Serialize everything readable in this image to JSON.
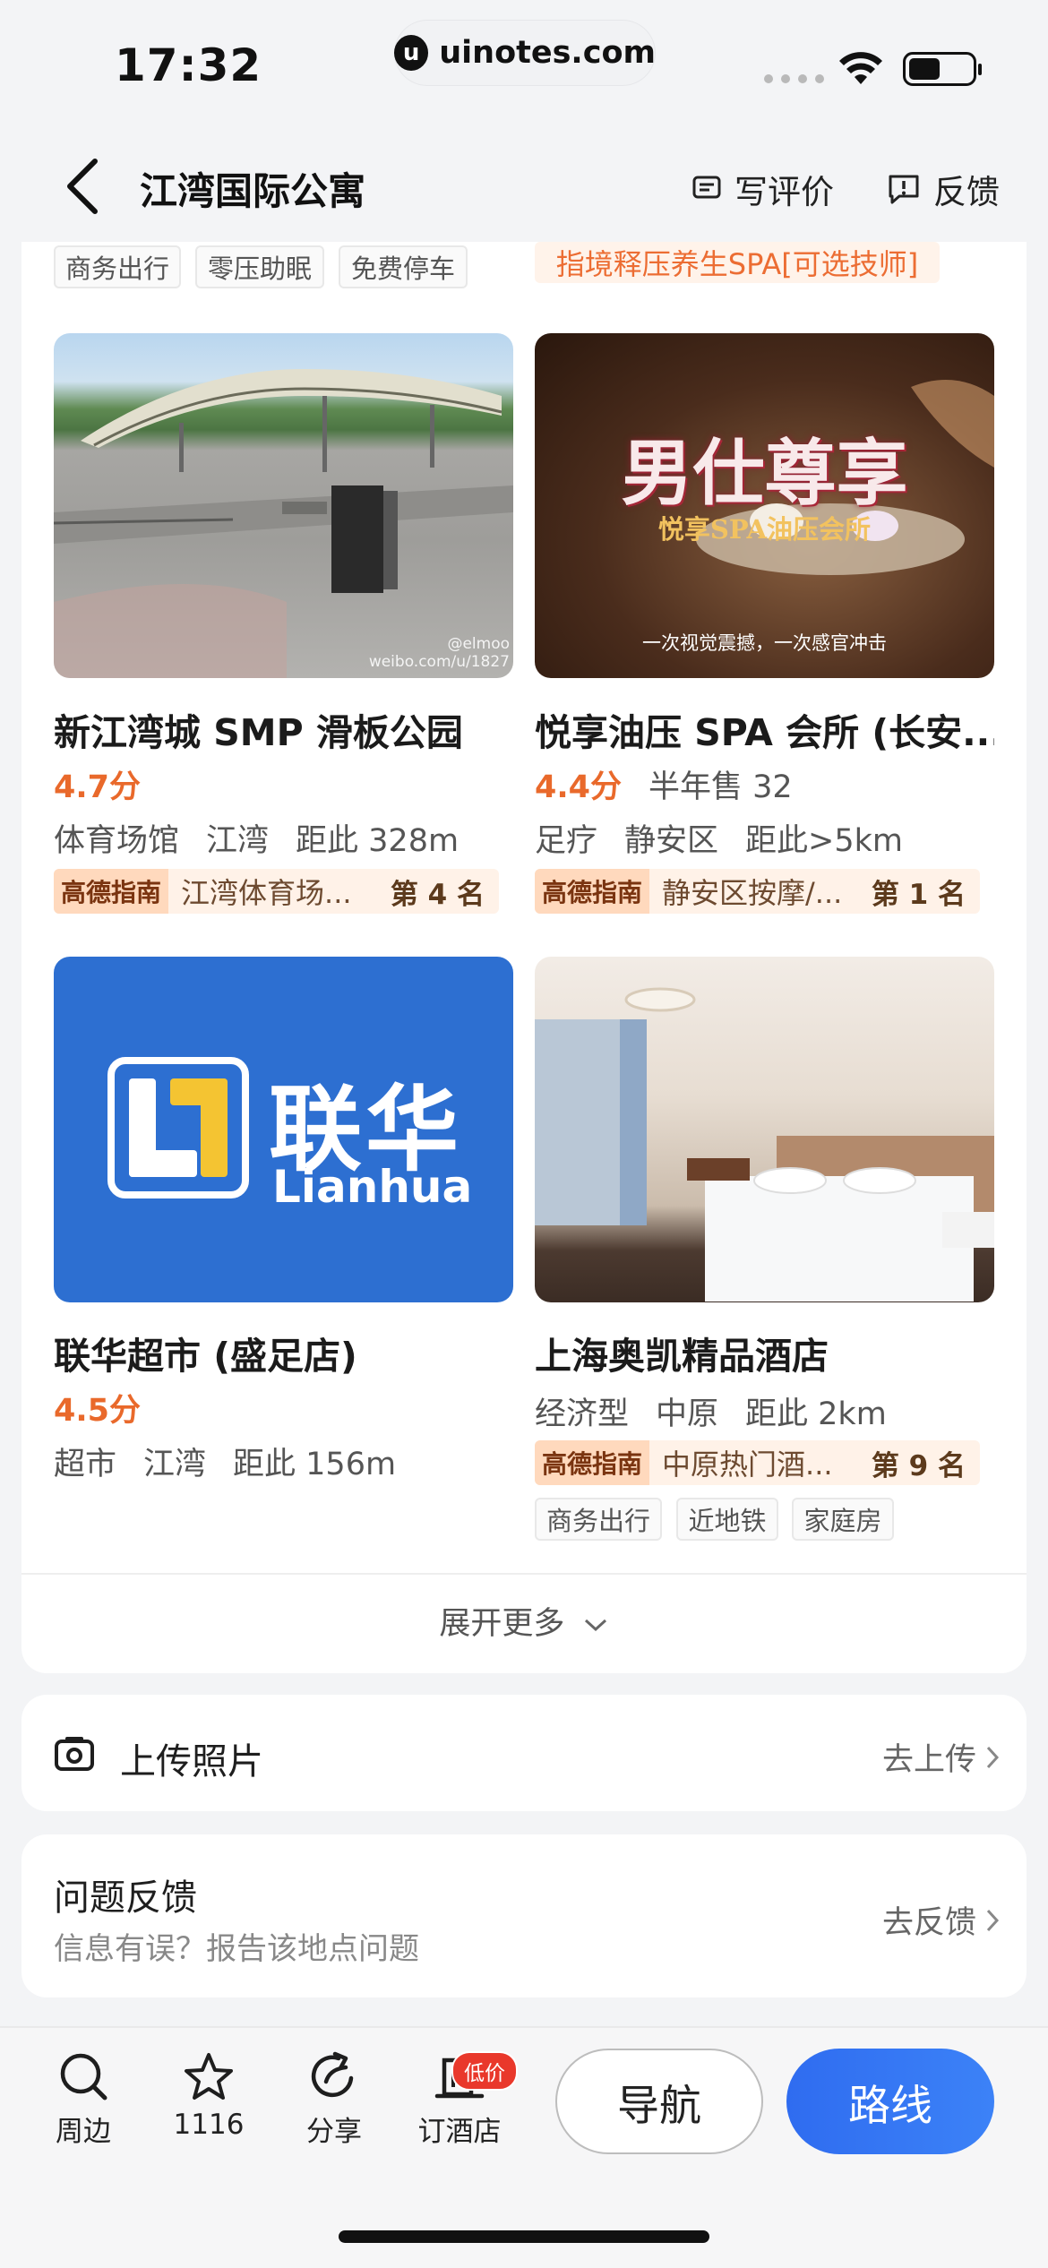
{
  "status_bar": {
    "time": "17:32",
    "url": "uinotes.com"
  },
  "header": {
    "title": "江湾国际公寓",
    "write_review": "写评价",
    "feedback": "反馈"
  },
  "top_tags": {
    "left": [
      "商务出行",
      "零压助眠",
      "免费停车"
    ],
    "right": "指境释压养生SPA[可选技师]"
  },
  "places": [
    {
      "name": "新江湾城 SMP 滑板公园",
      "score": "4.7分",
      "sales": "",
      "meta": [
        "体育场馆",
        "江湾",
        "距此 328m"
      ],
      "rank_guide": "高德指南",
      "rank_text": "江湾体育场...",
      "rank_no": "第 4 名",
      "image_watermark": [
        "@elmoo",
        "weibo.com/u/1827"
      ]
    },
    {
      "name": "悦享油压 SPA 会所 (长安...",
      "score": "4.4分",
      "sales": "半年售 32",
      "meta": [
        "足疗",
        "静安区",
        "距此>5km"
      ],
      "rank_guide": "高德指南",
      "rank_text": "静安区按摩/...",
      "rank_no": "第 1 名",
      "image_text": {
        "big": "男仕尊享",
        "sub": "悦享SPA油压会所",
        "caption": "一次视觉震撼，一次感官冲击"
      }
    },
    {
      "name": "联华超市 (盛足店)",
      "score": "4.5分",
      "sales": "",
      "meta": [
        "超市",
        "江湾",
        "距此 156m"
      ],
      "logo": {
        "cn": "联华",
        "en": "Lianhua"
      }
    },
    {
      "name": "上海奥凯精品酒店",
      "score": "",
      "sales": "",
      "meta": [
        "经济型",
        "中原",
        "距此 2km"
      ],
      "rank_guide": "高德指南",
      "rank_text": "中原热门酒...",
      "rank_no": "第 9 名",
      "tags": [
        "商务出行",
        "近地铁",
        "家庭房"
      ]
    }
  ],
  "expand": {
    "label": "展开更多"
  },
  "upload": {
    "label": "上传照片",
    "action": "去上传"
  },
  "report": {
    "label": "问题反馈",
    "sub": "信息有误？报告该地点问题",
    "action": "去反馈"
  },
  "bottom_bar": {
    "tabs": [
      {
        "label": "周边",
        "icon": "search-icon"
      },
      {
        "label": "1116",
        "icon": "star-icon"
      },
      {
        "label": "分享",
        "icon": "share-icon"
      },
      {
        "label": "订酒店",
        "icon": "hotel-icon",
        "badge": "低价"
      }
    ],
    "navigate": "导航",
    "route": "路线"
  },
  "colors": {
    "accent": "#2f6cf0",
    "score": "#e9692b",
    "badge": "#e9382b",
    "lianhua_blue": "#2d6fd1",
    "lianhua_yellow": "#f4c432"
  }
}
